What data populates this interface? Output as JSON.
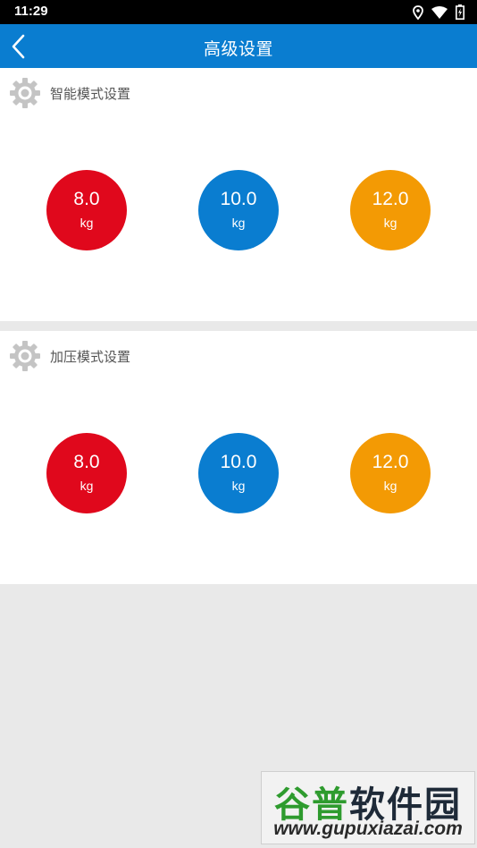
{
  "status_bar": {
    "time": "11:29",
    "icons": [
      "location-icon",
      "wifi-icon",
      "battery-icon"
    ]
  },
  "app_bar": {
    "title": "高级设置",
    "back_icon": "chevron-left-icon",
    "color": "#0a7dd0"
  },
  "sections": [
    {
      "label": "智能模式设置",
      "icon": "gear-icon",
      "options": [
        {
          "value": "8.0",
          "unit": "kg",
          "color": "#e0081c"
        },
        {
          "value": "10.0",
          "unit": "kg",
          "color": "#0a7dd0"
        },
        {
          "value": "12.0",
          "unit": "kg",
          "color": "#f39a04"
        }
      ]
    },
    {
      "label": "加压模式设置",
      "icon": "gear-icon",
      "options": [
        {
          "value": "8.0",
          "unit": "kg",
          "color": "#e0081c"
        },
        {
          "value": "10.0",
          "unit": "kg",
          "color": "#0a7dd0"
        },
        {
          "value": "12.0",
          "unit": "kg",
          "color": "#f39a04"
        }
      ]
    }
  ],
  "watermark": {
    "title_part1": "谷普",
    "title_part2": "软件园",
    "url": "www.gupuxiazai.com"
  }
}
